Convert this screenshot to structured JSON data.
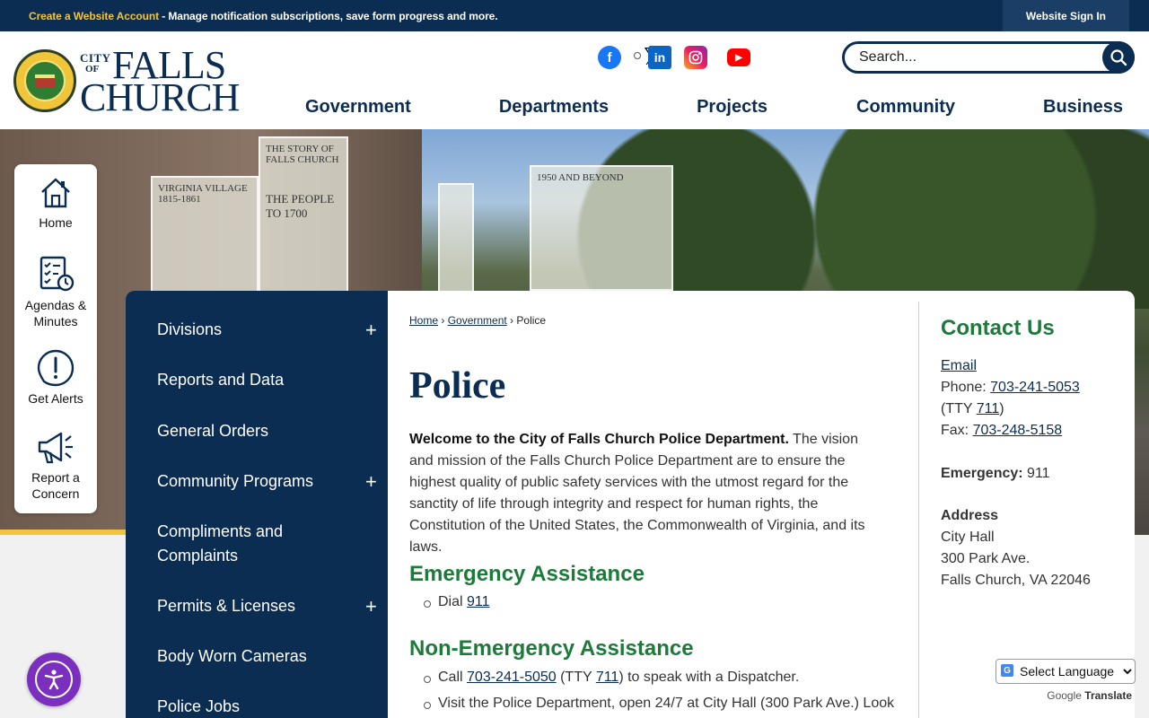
{
  "topbar": {
    "create_account": "Create a Website Account",
    "message": " - Manage notification subscriptions, save form progress and more.",
    "sign_in": "Website Sign In"
  },
  "logo": {
    "city": "CITY",
    "of": "OF",
    "falls": "FALLS",
    "church": "CHURCH"
  },
  "social": [
    "facebook-icon",
    "x-icon",
    "instagram-icon",
    "youtube-icon",
    "linkedin-icon"
  ],
  "search": {
    "placeholder": "Search..."
  },
  "nav": [
    "Government",
    "Departments",
    "Projects",
    "Community",
    "Business"
  ],
  "hero_panels": [
    "VIRGINIA VILLAGE 1815-1861",
    "THE STORY OF FALLS CHURCH",
    "THE PEOPLE TO 1700",
    "1950 AND BEYOND"
  ],
  "quick_links": [
    "Home",
    "Agendas & Minutes",
    "Get Alerts",
    "Report a Concern"
  ],
  "sidebar": [
    {
      "label": "Divisions",
      "expandable": true
    },
    {
      "label": "Reports and Data",
      "expandable": false
    },
    {
      "label": "General Orders",
      "expandable": false
    },
    {
      "label": "Community Programs",
      "expandable": true
    },
    {
      "label": "Compliments and Complaints",
      "expandable": false
    },
    {
      "label": "Permits & Licenses",
      "expandable": true
    },
    {
      "label": "Body Worn Cameras",
      "expandable": false
    },
    {
      "label": "Police Jobs",
      "expandable": false
    }
  ],
  "breadcrumb": {
    "home": "Home",
    "government": "Government",
    "current": "Police"
  },
  "page": {
    "title": "Police",
    "intro_bold": "Welcome to the City of Falls Church Police Department.",
    "intro_rest": " The vision and mission of the Falls Church Police Department are to ensure the highest quality of public safety services with the utmost regard for the sanctity of life through integrity and respect for human rights, the Constitution of the United States, the Commonwealth of Virginia, and its laws.",
    "emergency_heading": "Emergency Assistance",
    "emergency_dial": "Dial ",
    "emergency_number": "911",
    "nonemergency_heading": "Non-Emergency Assistance",
    "call_prefix": "Call ",
    "call_number": "703-241-5050",
    "call_tty_prefix": " (TTY ",
    "call_tty": "711",
    "call_suffix": ") to speak with a Dispatcher.",
    "visit_text": "Visit the Police Department, open 24/7 at City Hall (300 Park Ave.) Look"
  },
  "contact": {
    "heading": "Contact Us",
    "email": "Email",
    "phone_label": "Phone: ",
    "phone": "703-241-5053",
    "tty_prefix": "(TTY ",
    "tty": "711",
    "tty_suffix": ")",
    "fax_label": "Fax: ",
    "fax": "703-248-5158",
    "emergency_label": "Emergency:",
    "emergency": " 911",
    "address_label": "Address",
    "address_line1": "City Hall",
    "address_line2": "300 Park Ave.",
    "address_line3": "Falls Church, VA 22046"
  },
  "translate": {
    "select_label": "Select Language",
    "powered_by": "Google",
    "translate": "Translate"
  },
  "colors": {
    "navy": "#0b2d52",
    "green": "#1e7a3b",
    "gold": "#f2c33b",
    "accessibility": "#7b2fbf"
  }
}
